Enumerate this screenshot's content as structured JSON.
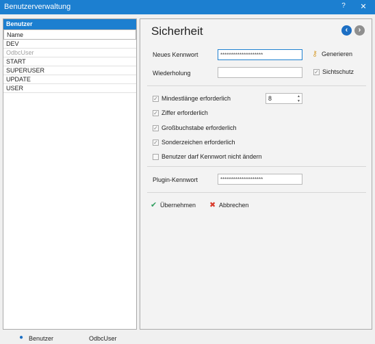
{
  "window": {
    "title": "Benutzerverwaltung",
    "help_label": "?",
    "close_label": "✕"
  },
  "sidebar": {
    "header": "Benutzer",
    "items": [
      {
        "label": "Name"
      },
      {
        "label": "DEV"
      },
      {
        "label": "OdbcUser"
      },
      {
        "label": "START"
      },
      {
        "label": "SUPERUSER"
      },
      {
        "label": "UPDATE"
      },
      {
        "label": "USER"
      }
    ]
  },
  "main": {
    "title": "Sicherheit",
    "back_icon": "arrow-left-circle-icon",
    "forward_icon": "arrow-right-circle-icon",
    "new_password_label": "Neues Kennwort",
    "new_password_value": "********************",
    "generate_label": "Generieren",
    "repeat_label": "Wiederholung",
    "repeat_value": "",
    "privacy_label": "Sichtschutz",
    "privacy_checked": true,
    "min_length_label": "Mindestlänge erforderlich",
    "min_length_value": "8",
    "digit_label": "Ziffer erforderlich",
    "uppercase_label": "Großbuchstabe erforderlich",
    "special_label": "Sonderzeichen erforderlich",
    "no_change_label": "Benutzer darf Kennwort nicht ändern",
    "plugin_password_label": "Plugin-Kennwort",
    "plugin_password_value": "********************",
    "apply_label": "Übernehmen",
    "cancel_label": "Abbrechen"
  },
  "statusbar": {
    "user_label": "Benutzer",
    "user_value": "OdbcUser"
  },
  "colors": {
    "accent": "#1c7fd0",
    "apply_green": "#2e9e5e",
    "cancel_red": "#d93a2b"
  }
}
